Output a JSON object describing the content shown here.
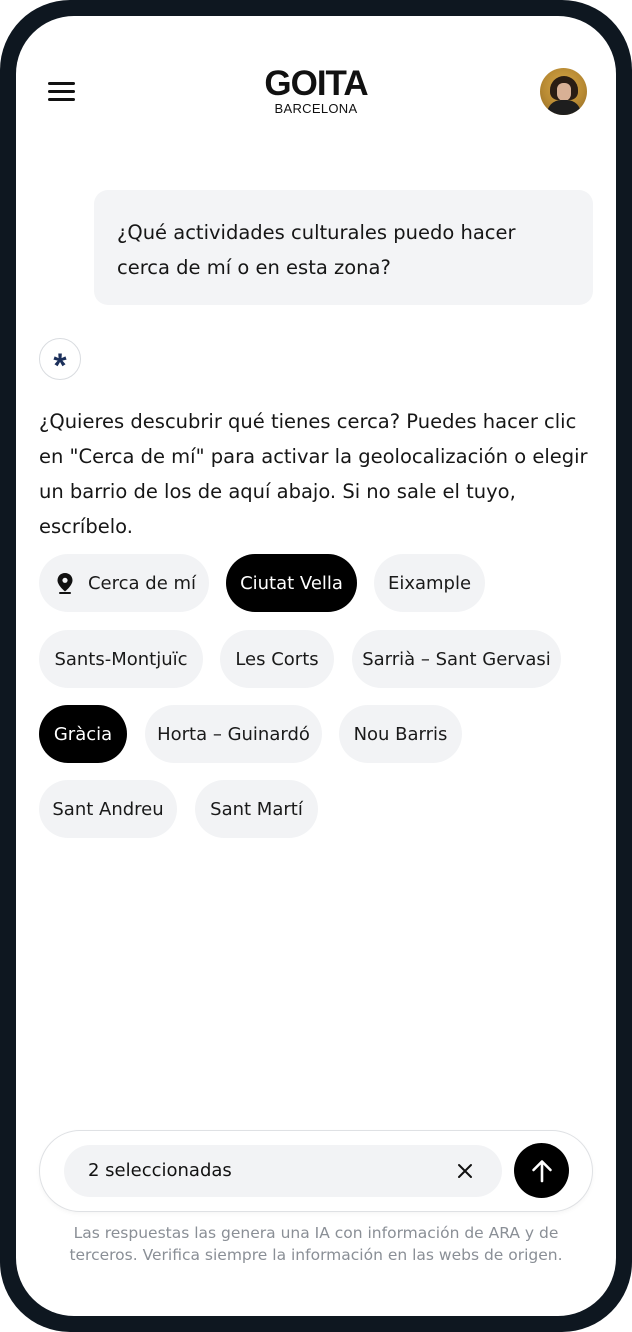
{
  "header": {
    "menu_icon": "hamburger-menu-icon",
    "logo_title": "GOITA",
    "logo_subtitle": "BARCELONA",
    "avatar": "user-avatar"
  },
  "conversation": {
    "user_message": "¿Qué actividades culturales puedo hacer cerca de mí o en esta zona?",
    "assistant_icon": "asterisk-icon",
    "assistant_message": "¿Quieres descubrir qué tienes cerca? Puedes hacer clic en \"Cerca de mí\" para activar la geolocalización o elegir un barrio de los de aquí abajo. Si no sale el tuyo, escríbelo."
  },
  "chips": [
    {
      "label": "Cerca de mí",
      "icon": "location-pin-icon",
      "selected": false
    },
    {
      "label": "Ciutat Vella",
      "selected": true
    },
    {
      "label": "Eixample",
      "selected": false
    },
    {
      "label": "Sants-Montjuïc",
      "selected": false
    },
    {
      "label": "Les Corts",
      "selected": false
    },
    {
      "label": "Sarrià – Sant Gervasi",
      "selected": false
    },
    {
      "label": "Gràcia",
      "selected": true
    },
    {
      "label": "Horta – Guinardó",
      "selected": false
    },
    {
      "label": "Nou Barris",
      "selected": false
    },
    {
      "label": "Sant Andreu",
      "selected": false
    },
    {
      "label": "Sant Martí",
      "selected": false
    }
  ],
  "composer": {
    "value": "2 seleccionadas",
    "clear_icon": "close-icon",
    "send_icon": "arrow-up-icon"
  },
  "disclaimer": "Las respuestas las genera una IA con información de ARA y de terceros. Verifica siempre la información en las webs de origen.",
  "colors": {
    "frame": "#0e1720",
    "chip_bg": "#f2f3f5",
    "chip_selected_bg": "#000000",
    "accent_asterisk": "#1b2f5a"
  }
}
